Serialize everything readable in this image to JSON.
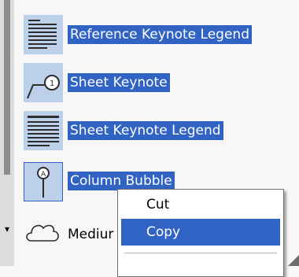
{
  "items": [
    {
      "label": "Reference Keynote Legend",
      "icon": "legend-table-icon"
    },
    {
      "label": "Sheet Keynote",
      "icon": "keynote-tag-icon"
    },
    {
      "label": "Sheet Keynote Legend",
      "icon": "legend-table-icon"
    },
    {
      "label": "Column Bubble",
      "icon": "column-bubble-icon"
    },
    {
      "label": "Mediur",
      "icon": "cloud-icon"
    }
  ],
  "context_menu": {
    "cut": "Cut",
    "copy": "Copy"
  },
  "colors": {
    "selection": "#3163c5",
    "thumb_bg": "#bcd0ea"
  }
}
